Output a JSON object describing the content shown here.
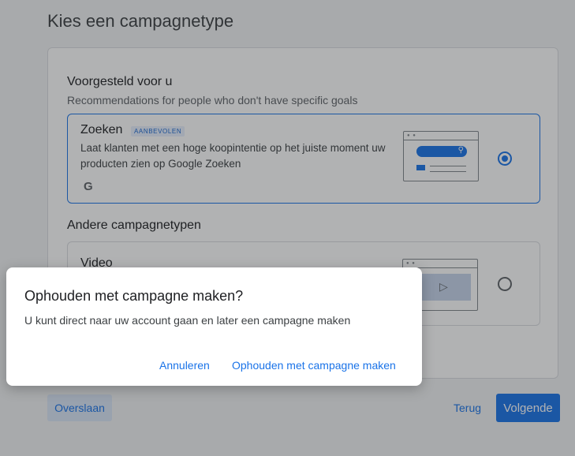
{
  "page": {
    "title": "Kies een campagnetype"
  },
  "suggested": {
    "title": "Voorgesteld voor u",
    "subtitle": "Recommendations for people who don't have specific goals"
  },
  "search_option": {
    "title": "Zoeken",
    "badge": "AANBEVOLEN",
    "description": "Laat klanten met een hoge koopintentie op het juiste moment uw producten zien op Google Zoeken",
    "logo": "G",
    "selected": true
  },
  "other": {
    "title": "Andere campagnetypen"
  },
  "video_option": {
    "title": "Video",
    "selected": false
  },
  "footer": {
    "skip_label": "Overslaan",
    "back_label": "Terug",
    "next_label": "Volgende"
  },
  "dialog": {
    "title": "Ophouden met campagne maken?",
    "body": "U kunt direct naar uw account gaan en later een campagne maken",
    "cancel_label": "Annuleren",
    "confirm_label": "Ophouden met campagne maken"
  },
  "colors": {
    "accent": "#1a73e8",
    "badge_bg": "#e8f0fe",
    "scrim": "rgba(32,33,36,0.35)"
  }
}
